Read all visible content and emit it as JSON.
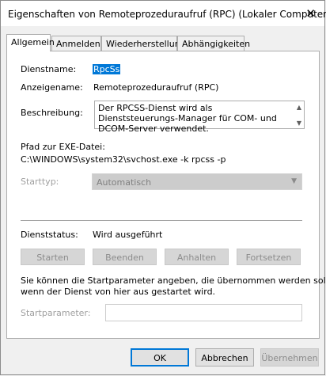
{
  "window": {
    "title": "Eigenschaften von Remoteprozeduraufruf (RPC) (Lokaler Computer)",
    "close_glyph": "✕"
  },
  "tabs": [
    {
      "label": "Allgemein",
      "active": true
    },
    {
      "label": "Anmelden"
    },
    {
      "label": "Wiederherstellung"
    },
    {
      "label": "Abhängigkeiten"
    }
  ],
  "general": {
    "service_name_label": "Dienstname:",
    "service_name_value": "RpcSs",
    "display_name_label": "Anzeigename:",
    "display_name_value": "Remoteprozeduraufruf (RPC)",
    "description_label": "Beschreibung:",
    "description_value": "Der RPCSS-Dienst wird als Dienststeuerungs-Manager für COM- und DCOM-Server verwendet.",
    "path_label": "Pfad zur EXE-Datei:",
    "path_value": "C:\\WINDOWS\\system32\\svchost.exe -k rpcss -p",
    "startup_type_label": "Starttyp:",
    "startup_type_value": "Automatisch",
    "status_label": "Dienststatus:",
    "status_value": "Wird ausgeführt",
    "buttons": {
      "start": "Starten",
      "stop": "Beenden",
      "pause": "Anhalten",
      "resume": "Fortsetzen"
    },
    "info_text_1": "Sie können die Startparameter angeben, die übernommen werden sollen,",
    "info_text_2": "wenn der Dienst von hier aus gestartet wird.",
    "start_params_label": "Startparameter:",
    "start_params_value": ""
  },
  "footer": {
    "ok": "OK",
    "cancel": "Abbrechen",
    "apply": "Übernehmen"
  }
}
